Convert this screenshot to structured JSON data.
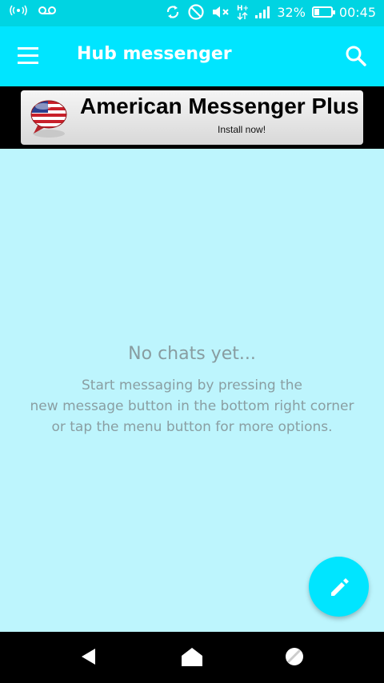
{
  "status_bar": {
    "battery_percent": "32%",
    "battery_level": 0.32,
    "time": "00:45",
    "network_type": "H+",
    "icons": [
      "wifi-hotspot-icon",
      "voicemail-icon",
      "sync-icon",
      "do-not-disturb-icon",
      "mute-icon",
      "network-hplus-icon",
      "signal-icon",
      "battery-charging-icon"
    ]
  },
  "app_bar": {
    "title": "Hub messenger",
    "menu_icon": "hamburger-menu-icon",
    "search_icon": "search-icon"
  },
  "ad": {
    "title": "American Messenger Plus",
    "subtitle": "Install now!",
    "icon": "american-flag-chat-icon"
  },
  "empty_state": {
    "title": "No chats yet...",
    "line1": "Start messaging by pressing the",
    "line2": "new message button in the bottom right corner",
    "line3": "or tap the menu button for more options."
  },
  "fab": {
    "icon": "pencil-icon"
  },
  "nav_bar": {
    "icons": [
      "back-icon",
      "home-icon",
      "recents-icon"
    ]
  },
  "colors": {
    "status_bar": "#00d4e2",
    "app_bar": "#00e5ff",
    "background": "#bdf5fd",
    "fab": "#00e5ff",
    "empty_text": "#8a9ea2"
  }
}
